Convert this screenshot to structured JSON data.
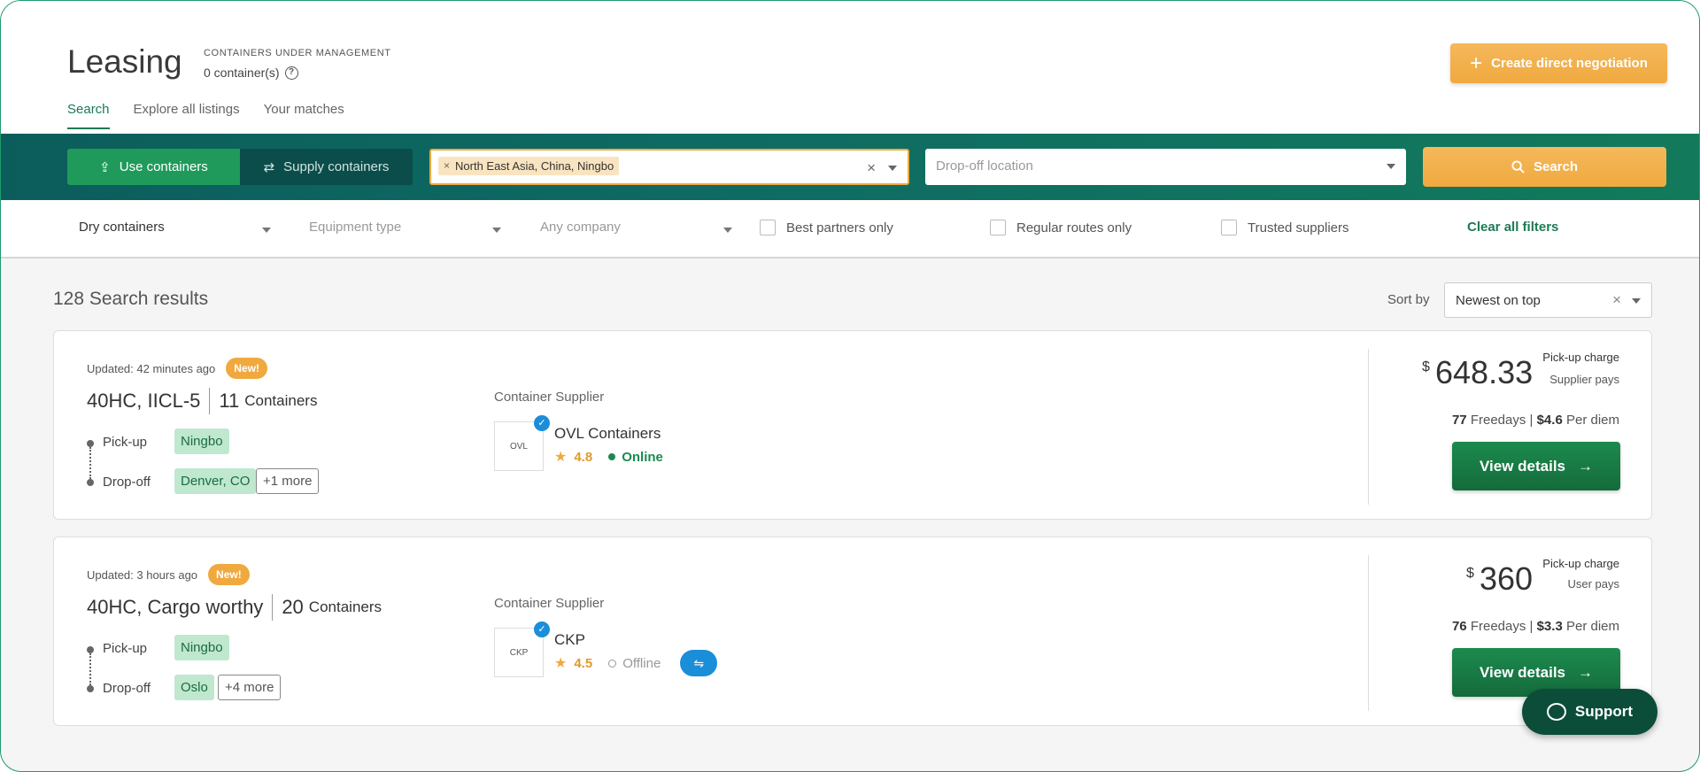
{
  "header": {
    "title": "Leasing",
    "cum_label": "CONTAINERS UNDER MANAGEMENT",
    "cum_count": "0 container(s)",
    "create_button": "Create direct negotiation",
    "tabs": [
      "Search",
      "Explore all listings",
      "Your matches"
    ]
  },
  "search": {
    "mode_use": "Use containers",
    "mode_supply": "Supply containers",
    "pickup_chip": "North East Asia, China, Ningbo",
    "dropoff_placeholder": "Drop-off location",
    "search_button": "Search"
  },
  "filters": {
    "container_type": "Dry containers",
    "equipment_type": "Equipment type",
    "company": "Any company",
    "best_partners": "Best partners only",
    "regular_routes": "Regular routes only",
    "trusted_suppliers": "Trusted suppliers",
    "clear_all": "Clear all filters"
  },
  "results": {
    "count_text": "128 Search results",
    "sort_label": "Sort by",
    "sort_value": "Newest on top"
  },
  "listings": [
    {
      "updated": "Updated: 42 minutes ago",
      "badge": "New!",
      "title": "40HC, IICL-5",
      "count": "11",
      "count_label": "Containers",
      "pickup_label": "Pick-up",
      "pickup": "Ningbo",
      "dropoff_label": "Drop-off",
      "dropoff": "Denver, CO",
      "more": "+1 more",
      "supplier_label": "Container Supplier",
      "logo_text": "OVL",
      "supplier_name": "OVL Containers",
      "rating": "4.8",
      "status": "Online",
      "currency": "$",
      "price": "648.33",
      "charge_label": "Pick-up charge",
      "payer": "Supplier pays",
      "freedays": "77",
      "freedays_label": "Freedays",
      "per_diem": "$4.6",
      "per_diem_label": "Per diem",
      "button": "View details"
    },
    {
      "updated": "Updated: 3 hours ago",
      "badge": "New!",
      "title": "40HC, Cargo worthy",
      "count": "20",
      "count_label": "Containers",
      "pickup_label": "Pick-up",
      "pickup": "Ningbo",
      "dropoff_label": "Drop-off",
      "dropoff": "Oslo",
      "more": "+4 more",
      "supplier_label": "Container Supplier",
      "logo_text": "CKP",
      "supplier_name": "CKP",
      "rating": "4.5",
      "status": "Offline",
      "currency": "$",
      "price": "360",
      "charge_label": "Pick-up charge",
      "payer": "User pays",
      "freedays": "76",
      "freedays_label": "Freedays",
      "per_diem": "$3.3",
      "per_diem_label": "Per diem",
      "button": "View details"
    }
  ],
  "support": {
    "label": "Support"
  },
  "colors": {
    "brand_green": "#1c8a4e",
    "accent_orange": "#f0a93f",
    "band_teal": "#0e6a63",
    "verified_blue": "#1a8ed9"
  },
  "icons": [
    "help-icon",
    "plus-icon",
    "upload-icon",
    "transfer-icon",
    "clear-icon",
    "chevron-down-icon",
    "search-icon",
    "star-icon",
    "verified-icon",
    "handshake-icon",
    "arrow-right-icon",
    "chat-icon"
  ]
}
